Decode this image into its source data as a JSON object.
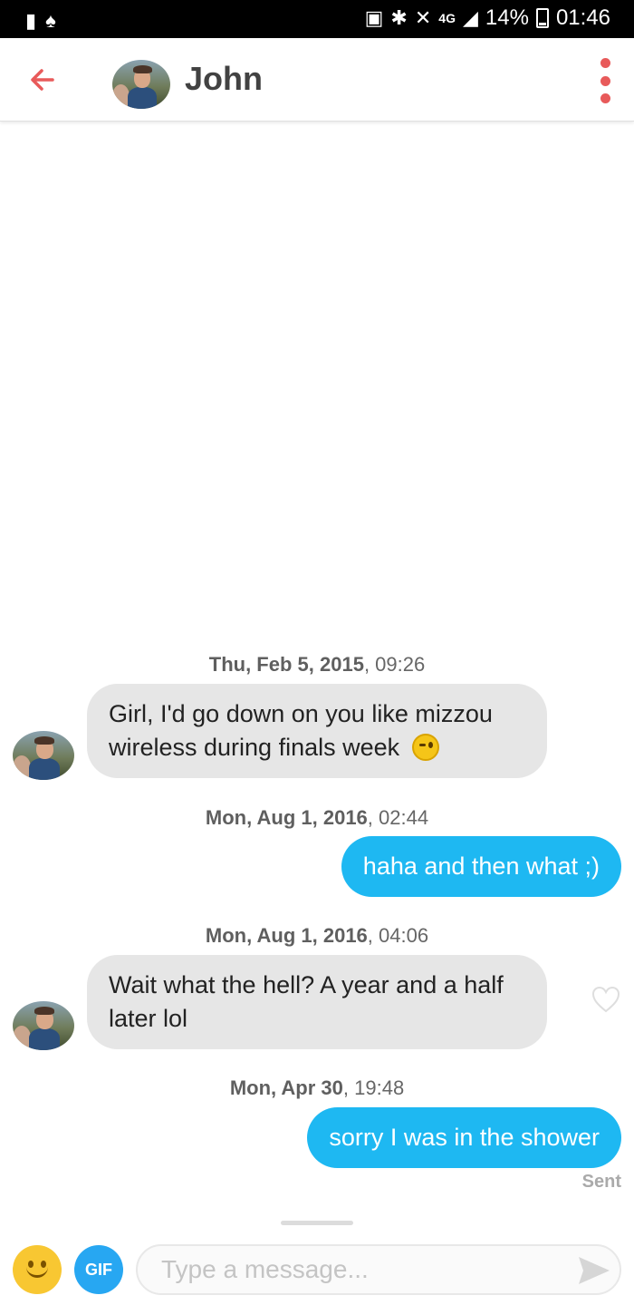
{
  "status_bar": {
    "battery": "14%",
    "time": "01:46",
    "network": "4G",
    "icons": [
      "notification-icon",
      "snapchat-icon",
      "vpn-icon",
      "bluetooth-icon",
      "mute-icon",
      "network-icon",
      "signal-icon",
      "battery-icon"
    ]
  },
  "header": {
    "name": "John",
    "back_icon": "arrow-left-icon",
    "menu_icon": "more-vertical-icon"
  },
  "messages": [
    {
      "type": "timestamp",
      "date": "Thu, Feb 5, 2015",
      "time": ", 09:26"
    },
    {
      "type": "incoming",
      "text": "Girl, I'd go down on you like mizzou wireless during finals week",
      "emoji": "winking-face-emoji"
    },
    {
      "type": "timestamp",
      "date": "Mon, Aug 1, 2016",
      "time": ", 02:44"
    },
    {
      "type": "outgoing",
      "text": "haha and then what ;)"
    },
    {
      "type": "timestamp",
      "date": "Mon, Aug 1, 2016",
      "time": ", 04:06"
    },
    {
      "type": "incoming",
      "text": "Wait what the hell? A year and a half later lol"
    },
    {
      "type": "timestamp",
      "date": "Mon, Apr 30",
      "time": ", 19:48"
    },
    {
      "type": "outgoing",
      "text": "sorry I was in the shower"
    }
  ],
  "sent_label": "Sent",
  "composer": {
    "gif_label": "GIF",
    "placeholder": "Type a message..."
  },
  "colors": {
    "accent": "#e85a5a",
    "outgoing_bubble": "#1eb8f2",
    "incoming_bubble": "#e6e6e6",
    "gif_button": "#27a7f2"
  }
}
